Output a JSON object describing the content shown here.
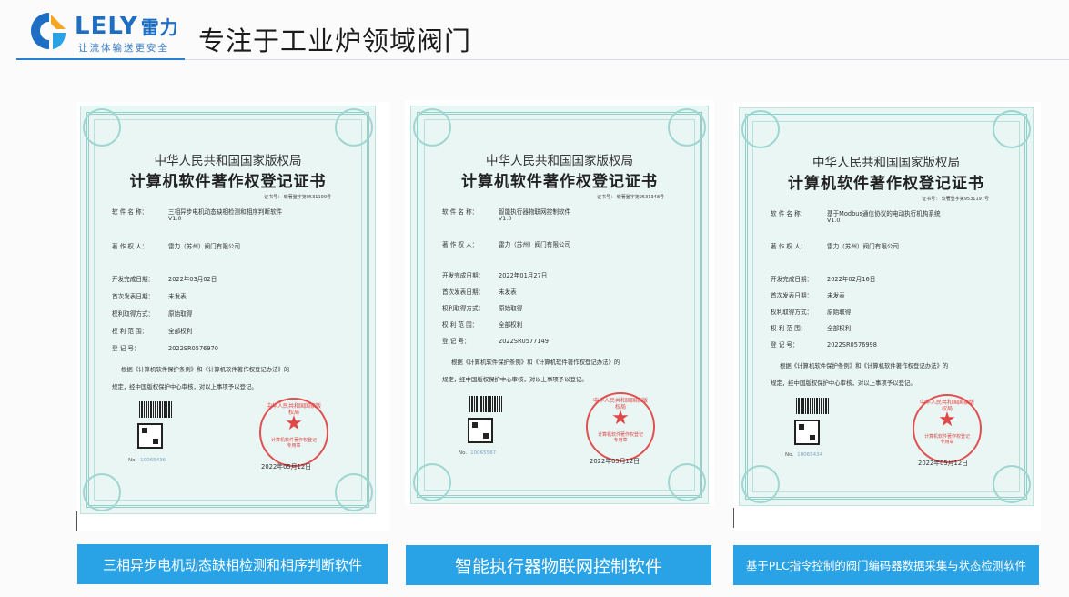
{
  "header": {
    "logo_text": "LELY",
    "logo_cn": "雷力",
    "logo_slogan": "让流体输送更安全",
    "title": "专注于工业炉领域阀门"
  },
  "certificates": [
    {
      "org": "中华人民共和国国家版权局",
      "name": "计算机软件著作权登记证书",
      "cert_no": "证书号： 软著登字第9531199号",
      "software_label": "软 件 名 称：",
      "software_name": "三相异步电机动态缺相检测和相序判断软件",
      "version": "V1.0",
      "owner_label": "著 作 权 人：",
      "owner": "雷力（苏州）阀门有限公司",
      "dev_date_label": "开发完成日期：",
      "dev_date": "2022年03月02日",
      "publish_label": "首次发表日期：",
      "publish": "未发表",
      "acquire_label": "权利取得方式：",
      "acquire": "原始取得",
      "scope_label": "权 利 范 围：",
      "scope": "全部权利",
      "reg_label": "登  记  号：",
      "reg_no": "2022SR0576970",
      "note1": "根据《计算机软件保护条例》和《计算机软件著作权登记办法》的",
      "note2": "规定，经中国版权保护中心审核，对以上事项予以登记。",
      "no_label": "No.",
      "no_value": "10065436",
      "issue_date": "2022年05月12日",
      "seal_top": "中华人民共和国国家版权局",
      "seal_bottom": "计算机软件著作权登记专用章",
      "caption": "三相异步电机动态缺相检测和相序判断软件"
    },
    {
      "org": "中华人民共和国国家版权局",
      "name": "计算机软件著作权登记证书",
      "cert_no": "证书号： 软著登字第9531348号",
      "software_label": "软 件 名 称：",
      "software_name": "智能执行器物联网控制软件",
      "version": "V1.0",
      "owner_label": "著 作 权 人：",
      "owner": "雷力（苏州）阀门有限公司",
      "dev_date_label": "开发完成日期：",
      "dev_date": "2022年01月27日",
      "publish_label": "首次发表日期：",
      "publish": "未发表",
      "acquire_label": "权利取得方式：",
      "acquire": "原始取得",
      "scope_label": "权 利 范 围：",
      "scope": "全部权利",
      "reg_label": "登  记  号：",
      "reg_no": "2022SR0577149",
      "note1": "根据《计算机软件保护条例》和《计算机软件著作权登记办法》的",
      "note2": "规定，经中国版权保护中心审核，对以上事项予以登记。",
      "no_label": "No.",
      "no_value": "10065587",
      "issue_date": "2022年05月12日",
      "seal_top": "中华人民共和国国家版权局",
      "seal_bottom": "计算机软件著作权登记专用章",
      "caption": "智能执行器物联网控制软件"
    },
    {
      "org": "中华人民共和国国家版权局",
      "name": "计算机软件著作权登记证书",
      "cert_no": "证书号： 软著登字第9531197号",
      "software_label": "软 件 名 称：",
      "software_name": "基于Modbus通信协议的电动执行机构系统",
      "version": "V1.0",
      "owner_label": "著 作 权 人：",
      "owner": "雷力（苏州）阀门有限公司",
      "dev_date_label": "开发完成日期：",
      "dev_date": "2022年02月16日",
      "publish_label": "首次发表日期：",
      "publish": "未发表",
      "acquire_label": "权利取得方式：",
      "acquire": "原始取得",
      "scope_label": "权 利 范 围：",
      "scope": "全部权利",
      "reg_label": "登  记  号：",
      "reg_no": "2022SR0576998",
      "note1": "根据《计算机软件保护条例》和《计算机软件著作权登记办法》的",
      "note2": "规定，经中国版权保护中心审核，对以上事项予以登记。",
      "no_label": "No.",
      "no_value": "10065434",
      "issue_date": "2022年05月12日",
      "seal_top": "中华人民共和国国家版权局",
      "seal_bottom": "计算机软件著作权登记专用章",
      "caption": "基于PLC指令控制的阀门编码器数据采集与状态检测软件"
    }
  ],
  "colors": {
    "accent": "#2aa2e6",
    "brand_blue": "#1e6fc4",
    "seal_red": "#e04848",
    "cert_bg": "#e9f6f4"
  }
}
